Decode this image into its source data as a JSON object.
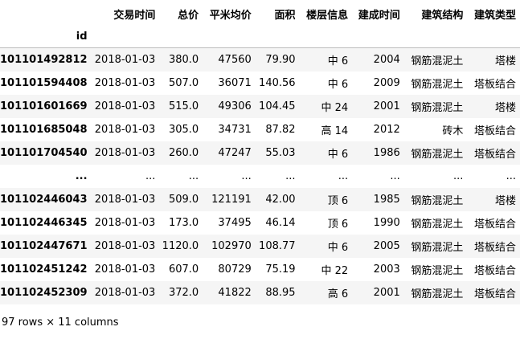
{
  "table": {
    "columns": [
      "交易时间",
      "总价",
      "平米均价",
      "面积",
      "楼层信息",
      "建成时间",
      "建筑结构",
      "建筑类型"
    ],
    "index_name": "id",
    "rows": [
      {
        "id": "101101492812",
        "cells": [
          "2018-01-03",
          "380.0",
          "47560",
          "79.90",
          "中 6",
          "2004",
          "钢筋混泥土",
          "塔楼"
        ]
      },
      {
        "id": "101101594408",
        "cells": [
          "2018-01-03",
          "507.0",
          "36071",
          "140.56",
          "中 6",
          "2009",
          "钢筋混泥土",
          "塔板结合"
        ]
      },
      {
        "id": "101101601669",
        "cells": [
          "2018-01-03",
          "515.0",
          "49306",
          "104.45",
          "中 24",
          "2001",
          "钢筋混泥土",
          "塔楼"
        ]
      },
      {
        "id": "101101685048",
        "cells": [
          "2018-01-03",
          "305.0",
          "34731",
          "87.82",
          "高 14",
          "2012",
          "砖木",
          "塔板结合"
        ]
      },
      {
        "id": "101101704540",
        "cells": [
          "2018-01-03",
          "260.0",
          "47247",
          "55.03",
          "中 6",
          "1986",
          "钢筋混泥土",
          "塔板结合"
        ]
      },
      {
        "id": "...",
        "cells": [
          "...",
          "...",
          "...",
          "...",
          "...",
          "...",
          "...",
          "..."
        ]
      },
      {
        "id": "101102446043",
        "cells": [
          "2018-01-03",
          "509.0",
          "121191",
          "42.00",
          "顶 6",
          "1985",
          "钢筋混泥土",
          "塔楼"
        ]
      },
      {
        "id": "101102446345",
        "cells": [
          "2018-01-03",
          "173.0",
          "37495",
          "46.14",
          "顶 6",
          "1990",
          "钢筋混泥土",
          "塔板结合"
        ]
      },
      {
        "id": "101102447671",
        "cells": [
          "2018-01-03",
          "1120.0",
          "102970",
          "108.77",
          "中 6",
          "2005",
          "钢筋混泥土",
          "塔板结合"
        ]
      },
      {
        "id": "101102451242",
        "cells": [
          "2018-01-03",
          "607.0",
          "80729",
          "75.19",
          "中 22",
          "2003",
          "钢筋混泥土",
          "塔板结合"
        ]
      },
      {
        "id": "101102452309",
        "cells": [
          "2018-01-03",
          "372.0",
          "41822",
          "88.95",
          "高 6",
          "2001",
          "钢筋混泥土",
          "塔板结合"
        ]
      }
    ]
  },
  "caption": "97 rows × 11 columns"
}
